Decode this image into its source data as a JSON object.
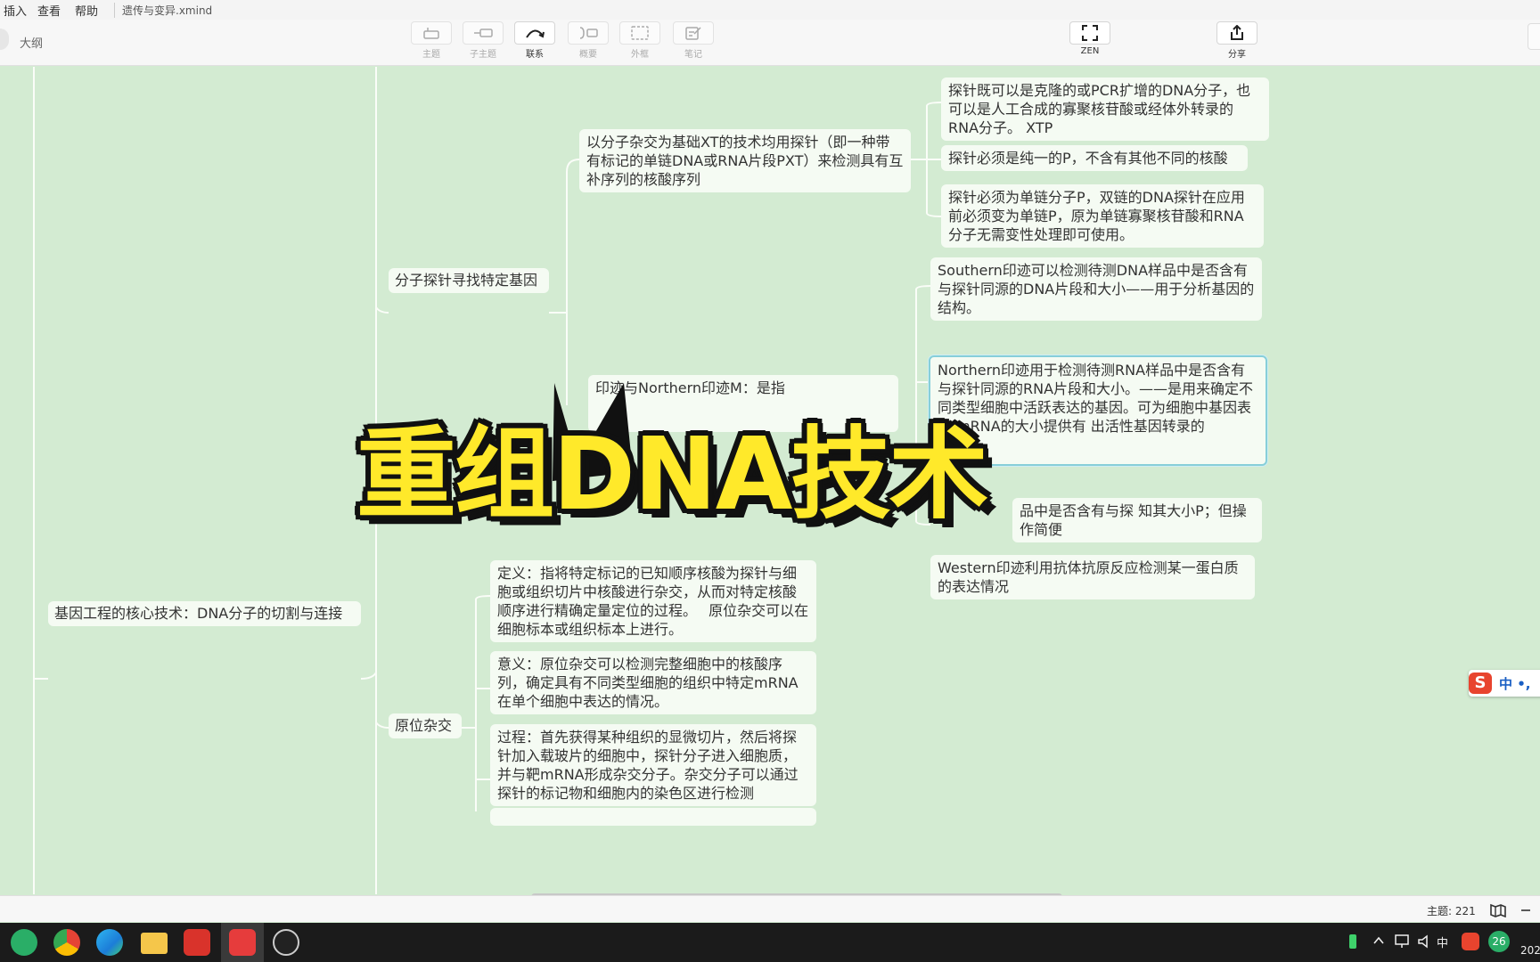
{
  "menubar": {
    "items": [
      "插入",
      "查看",
      "帮助"
    ],
    "filename": "遗传与变异.xmind"
  },
  "toolbar": {
    "outline_label": "大纲",
    "tools": [
      {
        "label": "主题",
        "icon": "topic-icon",
        "active": false
      },
      {
        "label": "子主题",
        "icon": "subtopic-icon",
        "active": false
      },
      {
        "label": "联系",
        "icon": "relationship-icon",
        "active": true
      },
      {
        "label": "概要",
        "icon": "summary-icon",
        "active": false
      },
      {
        "label": "外框",
        "icon": "boundary-icon",
        "active": false
      },
      {
        "label": "笔记",
        "icon": "note-icon",
        "active": false
      }
    ],
    "zen_label": "ZEN",
    "share_label": "分享"
  },
  "mindmap": {
    "root_branch": "基因工程的核心技术：DNA分子的切割与连接",
    "probe_topic": "分子探针寻找特定基因",
    "probe_def": "以分子杂交为基础XT的技术均用探针（即一种带有标记的单链DNA或RNA片段PXT）来检测具有互补序列的核酸序列",
    "probe_notes": [
      "探针既可以是克隆的或PCR扩增的DNA分子，也可以是人工合成的寡聚核苷酸或经体外转录的RNA分子。 XTP",
      "探针必须是纯一的P，不含有其他不同的核酸",
      "探针必须为单链分子P，双链的DNA探针在应用前必须变为单链P，原为单链寡聚核苷酸和RNA分子无需变性处理即可使用。"
    ],
    "blot_partial": "印迹与Northern印迹M：是指",
    "blot_notes": [
      "Southern印迹可以检测待测DNA样品中是否含有与探针同源的DNA片段和大小——用于分析基因的结构。",
      "Northern印迹用于检测待测RNA样品中是否含有与探针同源的RNA片段和大小。——是用来确定不同类型细胞中活跃表达的基因。可为细胞中基因表达 mRNA的大小提供有 出活性基因转录的",
      "品中是否含有与探 知其大小P；但操作简便",
      "Western印迹利用抗体抗原反应检测某一蛋白质的表达情况"
    ],
    "insitu_topic": "原位杂交",
    "insitu_notes": [
      "定义：指将特定标记的已知顺序核酸为探针与细胞或组织切片中核酸进行杂交，从而对特定核酸顺序进行精确定量定位的过程。　 原位杂交可以在细胞标本或组织标本上进行。",
      "意义：原位杂交可以检测完整细胞中的核酸序列，确定具有不同类型细胞的组织中特定mRNA在单个细胞中表达的情况。",
      "过程：首先获得某种组织的显微切片，然后将探针加入载玻片的细胞中，探针分子进入细胞质，并与靶mRNA形成杂交分子。杂交分子可以通过探针的标记物和细胞内的染色区进行检测"
    ]
  },
  "banner": {
    "title": "重组DNA技术"
  },
  "status": {
    "topic_count": "主题: 221"
  },
  "ime": {
    "logo": "S",
    "text": "中 •,"
  },
  "taskbar": {
    "apps": [
      "wechat-icon",
      "chrome-icon",
      "edge-icon",
      "file-explorer-icon",
      "wps-icon",
      "xmind-icon",
      "screen-recorder-icon"
    ],
    "tray_text": [
      "中",
      "26"
    ],
    "clock_partial": "202"
  },
  "colors": {
    "canvas_bg": "#d3ebd2",
    "node_bg": "#f5fbf3",
    "banner_fill": "#ffe92a",
    "banner_outline": "#111111",
    "selected_border": "#87cfd9"
  }
}
